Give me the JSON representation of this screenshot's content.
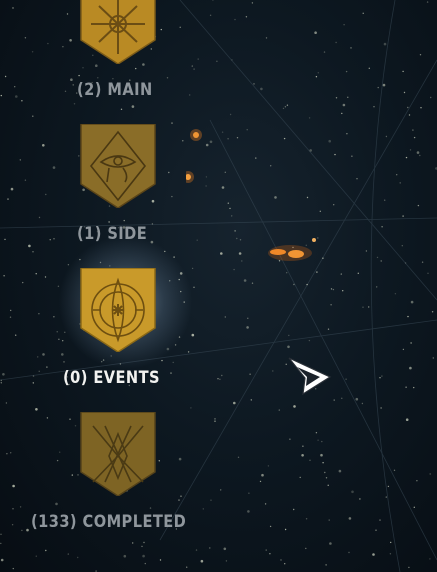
{
  "categories": [
    {
      "id": "main",
      "label": "(2) MAIN",
      "state": "dim",
      "icon": "knot-emblem-icon"
    },
    {
      "id": "side",
      "label": "(1) SIDE",
      "state": "dim",
      "icon": "eye-of-horus-emblem-icon"
    },
    {
      "id": "events",
      "label": "(0) EVENTS",
      "state": "selected",
      "icon": "star-eye-emblem-icon"
    },
    {
      "id": "completed",
      "label": "(133) COMPLETED",
      "state": "dim",
      "icon": "lattice-emblem-icon"
    }
  ],
  "colors": {
    "gold": "#c99a2a",
    "gold_dim": "#8a6d28",
    "text_dim": "#8f969c",
    "text_active": "#f2f2f0",
    "background": "#0b141c"
  },
  "cursor": {
    "icon": "arrow-cursor-icon"
  }
}
